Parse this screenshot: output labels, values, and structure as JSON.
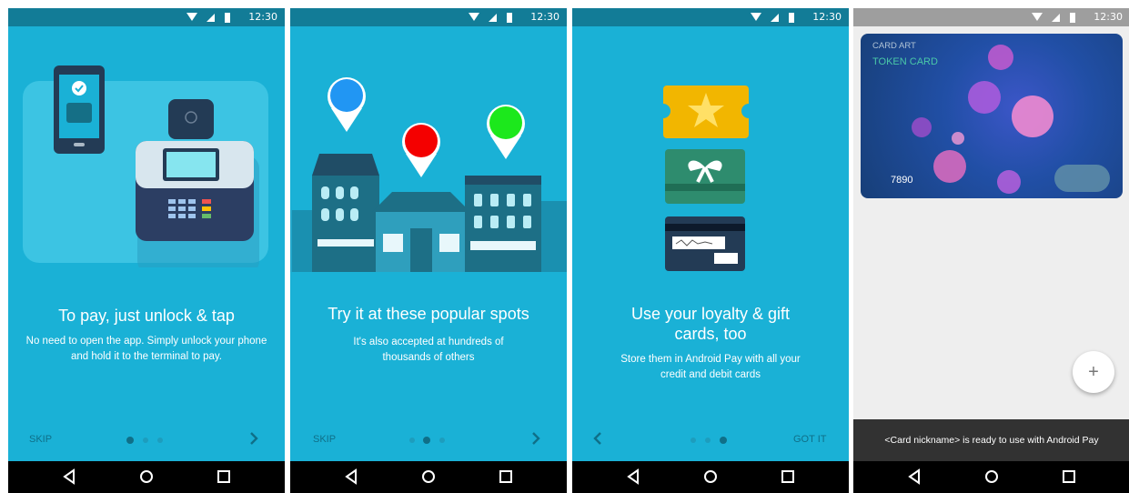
{
  "status": {
    "time": "12:30"
  },
  "onboarding": [
    {
      "title": "To pay, just unlock & tap",
      "body": "No need to open the app. Simply unlock your phone and hold it to the terminal to pay.",
      "left_action": "SKIP",
      "active_dot": 1,
      "illustration": "phone-and-payment-terminal"
    },
    {
      "title": "Try it at these popular spots",
      "body": "It's also accepted at hundreds of thousands of others",
      "left_action": "SKIP",
      "active_dot": 2,
      "illustration": "storefronts-with-map-pins",
      "pin_colors": [
        "#2196f3",
        "#f40000",
        "#1ce81c"
      ]
    },
    {
      "title": "Use your loyalty & gift cards, too",
      "body": "Store them in Android Pay with all your credit and debit cards",
      "right_action": "GOT IT",
      "active_dot": 3,
      "illustration": "loyalty-gift-credit-cards"
    }
  ],
  "wallet": {
    "card_art_label": "CARD ART",
    "token_label": "TOKEN CARD",
    "card_number": "7890",
    "fab_label": "+",
    "snackbar": "<Card nickname> is ready to use with Android Pay"
  },
  "colors": {
    "accent": "#1ab1d6",
    "status_bar": "#127c97",
    "card_bg": "#173f78"
  },
  "icons": [
    "wifi-icon",
    "signal-icon",
    "battery-icon",
    "back-icon",
    "home-icon",
    "recents-icon",
    "chevron-right-icon",
    "chevron-left-icon",
    "plus-icon"
  ]
}
